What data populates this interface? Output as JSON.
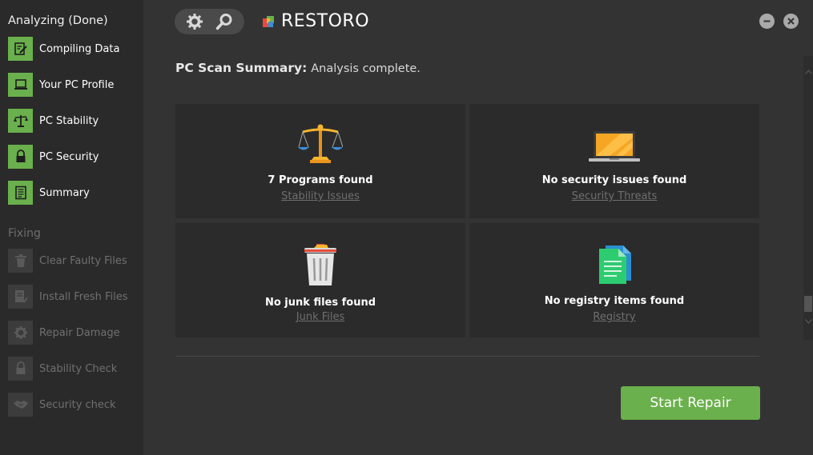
{
  "sidebar": {
    "title": "Analyzing (Done)",
    "analyzing_items": [
      {
        "label": "Compiling Data",
        "icon": "notepad-edit-icon"
      },
      {
        "label": "Your PC Profile",
        "icon": "laptop-icon"
      },
      {
        "label": "PC Stability",
        "icon": "scale-icon"
      },
      {
        "label": "PC Security",
        "icon": "lock-icon"
      },
      {
        "label": "Summary",
        "icon": "list-document-icon"
      }
    ],
    "fixing_title": "Fixing",
    "fixing_items": [
      {
        "label": "Clear Faulty Files",
        "icon": "trash-icon"
      },
      {
        "label": "Install Fresh Files",
        "icon": "install-file-icon"
      },
      {
        "label": "Repair Damage",
        "icon": "gear-icon"
      },
      {
        "label": "Stability Check",
        "icon": "lock-icon"
      },
      {
        "label": "Security check",
        "icon": "handshake-icon"
      }
    ]
  },
  "header": {
    "brand": "RESTORO"
  },
  "main": {
    "heading_bold": "PC Scan Summary:",
    "heading_rest": "Analysis complete.",
    "cards": [
      {
        "title": "7 Programs found",
        "link": "Stability Issues",
        "icon": "scale-icon"
      },
      {
        "title": "No security issues found",
        "link": "Security Threats",
        "icon": "laptop-icon"
      },
      {
        "title": "No junk files found",
        "link": "Junk Files",
        "icon": "trash-icon"
      },
      {
        "title": "No registry items found",
        "link": "Registry",
        "icon": "documents-icon"
      }
    ],
    "start_button": "Start Repair"
  },
  "colors": {
    "accent": "#6ab04c",
    "background": "#333333",
    "sidebar": "#2a2a2a",
    "card": "#2b2b2b"
  }
}
